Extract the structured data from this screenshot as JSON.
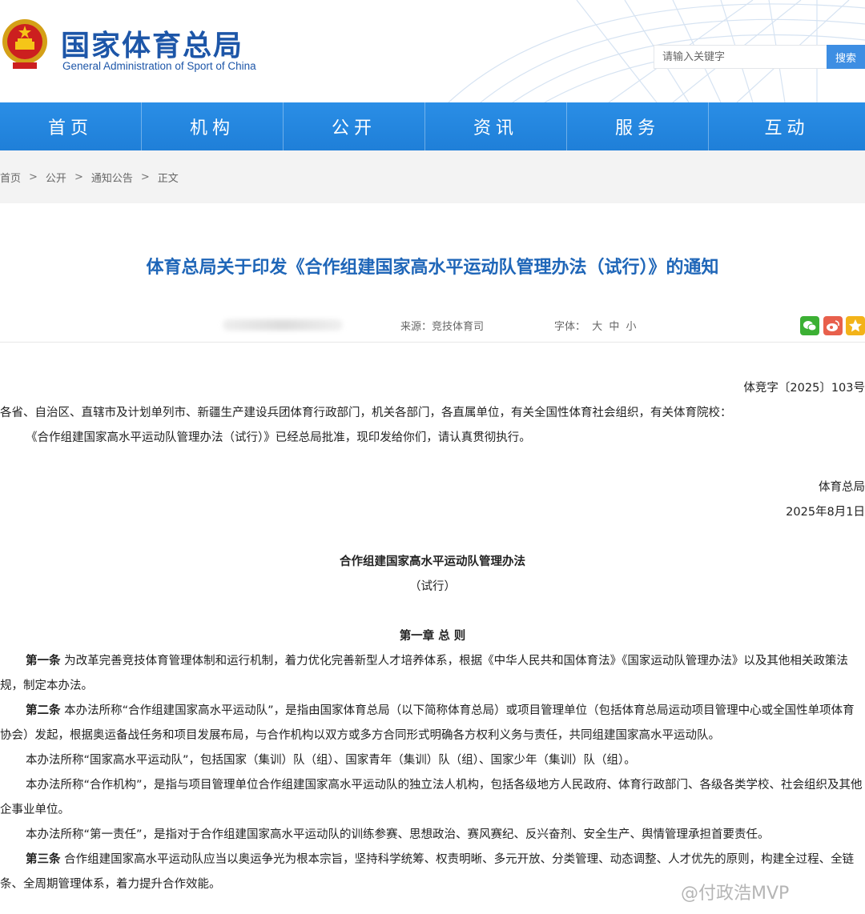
{
  "site": {
    "name_cn": "国家体育总局",
    "name_en": "General Administration of Sport of China"
  },
  "search": {
    "placeholder": "请输入关键字",
    "button": "搜索"
  },
  "nav": [
    "首页",
    "机构",
    "公开",
    "资讯",
    "服务",
    "互动"
  ],
  "breadcrumb": [
    "首页",
    "公开",
    "通知公告",
    "正文"
  ],
  "article": {
    "title": "体育总局关于印发《合作组建国家高水平运动队管理办法（试行）》的通知",
    "source": "来源：竞技体育司",
    "font_label": "字体：",
    "font_sizes": [
      "大",
      "中",
      "小"
    ],
    "doc_number": "体竞字〔2025〕103号",
    "addressee": "各省、自治区、直辖市及计划单列市、新疆生产建设兵团体育行政部门，机关各部门，各直属单位，有关全国性体育社会组织，有关体育院校：",
    "intro": "《合作组建国家高水平运动队管理办法（试行）》已经总局批准，现印发给你们，请认真贯彻执行。",
    "signature": "体育总局",
    "date": "2025年8月1日",
    "doc_title": "合作组建国家高水平运动队管理办法",
    "doc_subtitle": "（试行）",
    "chapter1": "第一章 总 则",
    "art1_label": "第一条",
    "art1": " 为改革完善竞技体育管理体制和运行机制，着力优化完善新型人才培养体系，根据《中华人民共和国体育法》《国家运动队管理办法》以及其他相关政策法规，制定本办法。",
    "art2_label": "第二条",
    "art2": " 本办法所称“合作组建国家高水平运动队”，是指由国家体育总局（以下简称体育总局）或项目管理单位（包括体育总局运动项目管理中心或全国性单项体育协会）发起，根据奥运备战任务和项目发展布局，与合作机构以双方或多方合同形式明确各方权利义务与责任，共同组建国家高水平运动队。",
    "art2_p2": "本办法所称“国家高水平运动队”，包括国家（集训）队（组）、国家青年（集训）队（组）、国家少年（集训）队（组）。",
    "art2_p3": "本办法所称“合作机构”，是指与项目管理单位合作组建国家高水平运动队的独立法人机构，包括各级地方人民政府、体育行政部门、各级各类学校、社会组织及其他企事业单位。",
    "art2_p4": "本办法所称“第一责任”，是指对于合作组建国家高水平运动队的训练参赛、思想政治、赛风赛纪、反兴奋剂、安全生产、舆情管理承担首要责任。",
    "art3_label": "第三条",
    "art3": " 合作组建国家高水平运动队应当以奥运争光为根本宗旨，坚持科学统筹、权责明晰、多元开放、分类管理、动态调整、人才优先的原则，构建全过程、全链条、全周期管理体系，着力提升合作效能。"
  },
  "watermark": "@付政浩MVP",
  "colors": {
    "brand_blue": "#1d56a8",
    "nav_blue": "#2a8ee6",
    "title_blue": "#1f66b8"
  }
}
